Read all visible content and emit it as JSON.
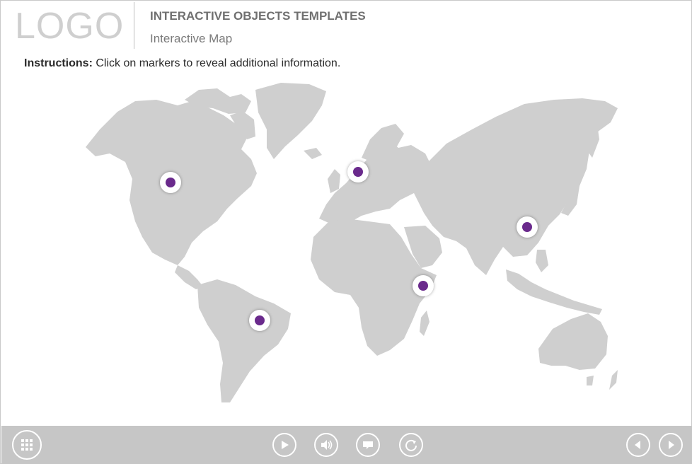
{
  "header": {
    "logo": "LOGO",
    "title": "INTERACTIVE OBJECTS TEMPLATES",
    "subtitle": "Interactive Map"
  },
  "instructions": {
    "label": "Instructions:",
    "text": "Click on markers to reveal additional information."
  },
  "map": {
    "land_color": "#cfcfcf",
    "markers": [
      {
        "name": "marker-north-america",
        "color": "#6a2a8c"
      },
      {
        "name": "marker-northern-europe",
        "color": "#6a2a8c"
      },
      {
        "name": "marker-east-asia",
        "color": "#6a2a8c"
      },
      {
        "name": "marker-east-africa",
        "color": "#6a2a8c"
      },
      {
        "name": "marker-south-america",
        "color": "#6a2a8c"
      }
    ]
  },
  "footer": {
    "bar_color": "#c6c6c6",
    "buttons": [
      {
        "name": "menu-button",
        "icon": "grid-icon"
      },
      {
        "name": "play-button",
        "icon": "play-icon"
      },
      {
        "name": "audio-button",
        "icon": "speaker-icon"
      },
      {
        "name": "captions-button",
        "icon": "caption-icon"
      },
      {
        "name": "replay-button",
        "icon": "replay-icon"
      },
      {
        "name": "back-button",
        "icon": "arrow-left-icon"
      },
      {
        "name": "next-button",
        "icon": "arrow-right-icon"
      }
    ]
  }
}
